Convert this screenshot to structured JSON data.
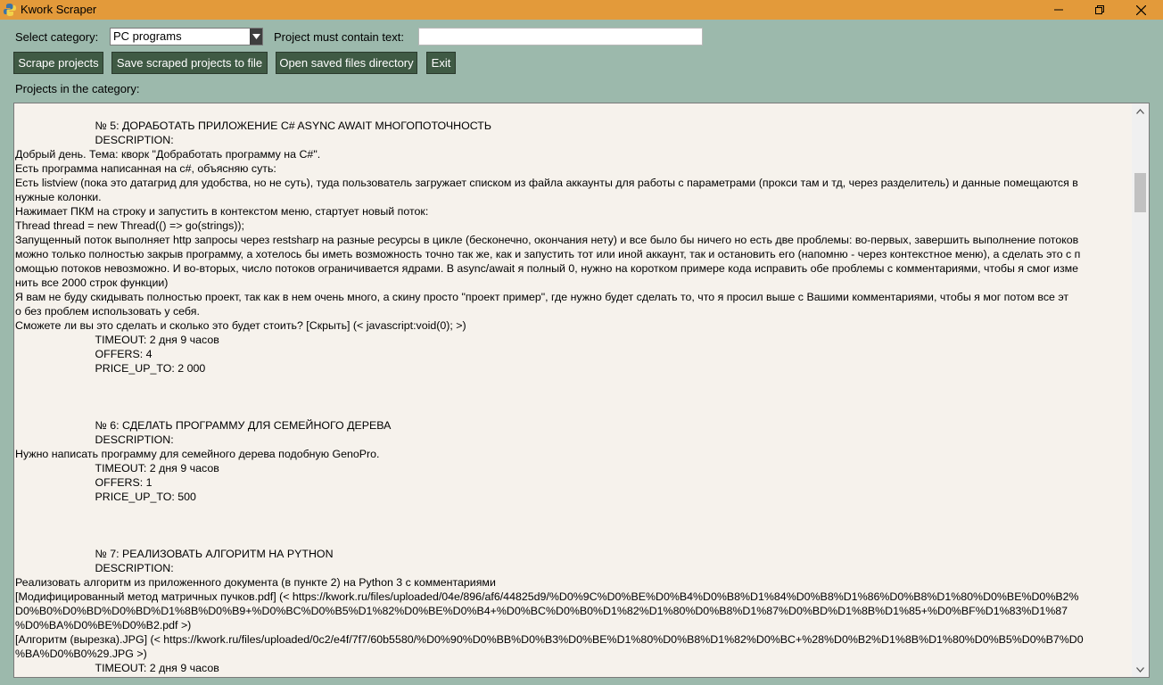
{
  "window": {
    "title": "Kwork Scraper",
    "accent_color": "#e39a3a",
    "background_color": "#9cb9ac",
    "controls": [
      "minimize-icon",
      "maximize-icon",
      "close-icon"
    ]
  },
  "toolbar": {
    "category_label": "Select category:",
    "category_value": "PC programs",
    "filter_label": "Project must contain text:",
    "filter_value": "",
    "scrape_label": "Scrape projects",
    "save_label": "Save scraped projects to file",
    "open_dir_label": "Open saved files directory",
    "exit_label": "Exit"
  },
  "projects": {
    "label": "Projects in the category:",
    "lines": [
      "                          № 5: ДОРАБОТАТЬ ПРИЛОЖЕНИЕ C# ASYNC AWAIT МНОГОПОТОЧНОСТЬ",
      "                          DESCRIPTION:",
      "Добрый день. Тема: кворк \"Добработать программу на C#\".",
      "Есть программа написанная на c#, объясняю суть:",
      "Есть listview (пока это датагрид для удобства, но не суть), туда пользователь загружает списком из файла аккаунты для работы с параметрами (прокси там и тд, через разделитель) и данные помещаются в",
      "нужные колонки.",
      "Нажимает ПКМ на строку и запустить в контекстом меню, стартует новый поток:",
      "Thread thread = new Thread(() => go(strings));",
      "Запущенный поток выполняет http запросы через restsharp на разные ресурсы в цикле (бесконечно, окончания нету) и все было бы ничего но есть две проблемы: во-первых, завершить выполнение потоков",
      "можно только полностью закрыв программу, а хотелось бы иметь возможность точно так же, как и запустить тот или иной аккаунт, так и остановить его (напомню - через контекстное меню), а сделать это с п",
      "омощью потоков невозможно. И во-вторых, число потоков ограничивается ядрами. В async/await я полный 0, нужно на коротком примере кода исправить обе проблемы с комментариями, чтобы я смог изме",
      "нить все 2000 строк функции)",
      "Я вам не буду скидывать полностью проект, так как в нем очень много, а скину просто \"проект пример\", где нужно будет сделать то, что я просил выше с Вашими комментариями, чтобы я мог потом все эт",
      "о без проблем использовать у себя.",
      "Сможете ли вы это сделать и сколько это будет стоить? [Скрыть] (< javascript:void(0); >)",
      "                          TIMEOUT: 2 дня 9 часов",
      "                          OFFERS: 4",
      "                          PRICE_UP_TO: 2 000",
      "",
      "",
      "",
      "                          № 6: СДЕЛАТЬ ПРОГРАММУ ДЛЯ СЕМЕЙНОГО ДЕРЕВА",
      "                          DESCRIPTION:",
      "Нужно написать программу для семейного дерева подобную GenoPro.",
      "                          TIMEOUT: 2 дня 9 часов",
      "                          OFFERS: 1",
      "                          PRICE_UP_TO: 500",
      "",
      "",
      "",
      "                          № 7: РЕАЛИЗОВАТЬ АЛГОРИТМ НА PYTHON",
      "                          DESCRIPTION:",
      "Реализовать алгоритм из приложенного документа (в пункте 2) на Python 3 с комментариями",
      "[Модифицированный метод матричных пучков.pdf] (< https://kwork.ru/files/uploaded/04e/896/af6/44825d9/%D0%9C%D0%BE%D0%B4%D0%B8%D1%84%D0%B8%D1%86%D0%B8%D1%80%D0%BE%D0%B2%",
      "D0%B0%D0%BD%D0%BD%D1%8B%D0%B9+%D0%BC%D0%B5%D1%82%D0%BE%D0%B4+%D0%BC%D0%B0%D1%82%D1%80%D0%B8%D1%87%D0%BD%D1%8B%D1%85+%D0%BF%D1%83%D1%87",
      "%D0%BA%D0%BE%D0%B2.pdf >)",
      "[Алгоритм (вырезка).JPG] (< https://kwork.ru/files/uploaded/0c2/e4f/7f7/60b5580/%D0%90%D0%BB%D0%B3%D0%BE%D1%80%D0%B8%D1%82%D0%BC+%28%D0%B2%D1%8B%D1%80%D0%B5%D0%B7%D0",
      "%BA%D0%B0%29.JPG >)",
      "                          TIMEOUT: 2 дня 9 часов"
    ]
  }
}
